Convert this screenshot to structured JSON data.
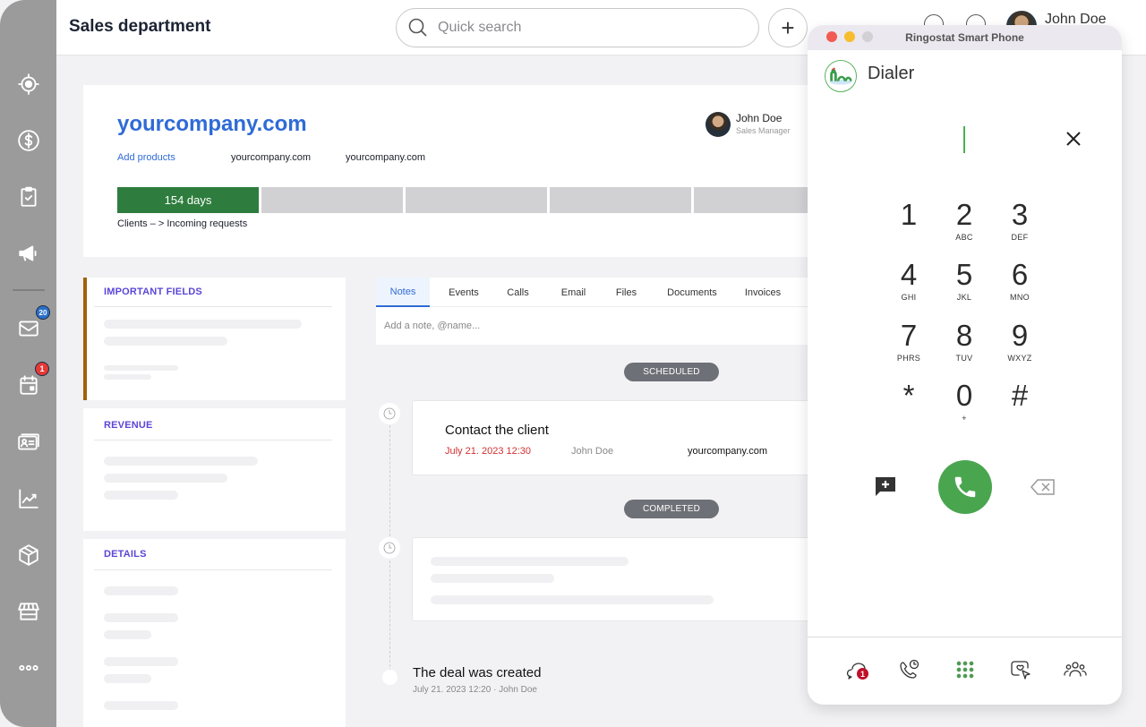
{
  "header": {
    "title": "Sales department",
    "search_placeholder": "Quick search",
    "add_button": "+",
    "user_name": "John Doe"
  },
  "sidebar": {
    "items": [
      {
        "name": "target",
        "icon": "target-icon"
      },
      {
        "name": "deals",
        "icon": "dollar-icon"
      },
      {
        "name": "tasks",
        "icon": "clipboard-check-icon"
      },
      {
        "name": "marketing",
        "icon": "megaphone-icon"
      },
      {
        "name": "mail",
        "icon": "mail-icon",
        "badge": "20"
      },
      {
        "name": "calendar",
        "icon": "calendar-icon",
        "badge": "1"
      },
      {
        "name": "contacts",
        "icon": "contact-cards-icon"
      },
      {
        "name": "analytics",
        "icon": "chart-icon"
      },
      {
        "name": "products",
        "icon": "box-icon"
      },
      {
        "name": "store",
        "icon": "store-icon"
      },
      {
        "name": "more",
        "icon": "more-icon"
      }
    ]
  },
  "deal": {
    "title": "yourcompany.com",
    "add_products": "Add products",
    "meta1": "yourcompany.com",
    "meta2": "yourcompany.com",
    "owner_name": "John Doe",
    "owner_role": "Sales Manager",
    "stages": [
      {
        "label": "154 days",
        "active": true
      },
      {
        "label": "",
        "active": false
      },
      {
        "label": "",
        "active": false
      },
      {
        "label": "",
        "active": false
      },
      {
        "label": "",
        "active": false
      }
    ],
    "pipeline": "Clients – > Incoming requests"
  },
  "panels": {
    "important": "IMPORTANT FIELDS",
    "revenue": "REVENUE",
    "details": "DETAILS"
  },
  "activity": {
    "tabs": [
      "Notes",
      "Events",
      "Calls",
      "Email",
      "Files",
      "Documents",
      "Invoices"
    ],
    "active_tab": "Notes",
    "note_placeholder": "Add a note, @name...",
    "scheduled_label": "SCHEDULED",
    "completed_label": "COMPLETED",
    "task": {
      "title": "Contact the client",
      "date": "July 21. 2023 12:30",
      "user": "John Doe",
      "company": "yourcompany.com"
    },
    "created": {
      "title": "The deal was created",
      "meta": "July 21. 2023 12:20 · John Doe"
    }
  },
  "phone": {
    "window_title": "Ringostat Smart Phone",
    "dialer_title": "Dialer",
    "keys": [
      {
        "digit": "1",
        "letters": ""
      },
      {
        "digit": "2",
        "letters": "ABC"
      },
      {
        "digit": "3",
        "letters": "DEF"
      },
      {
        "digit": "4",
        "letters": "GHI"
      },
      {
        "digit": "5",
        "letters": "JKL"
      },
      {
        "digit": "6",
        "letters": "MNO"
      },
      {
        "digit": "7",
        "letters": "PHRS"
      },
      {
        "digit": "8",
        "letters": "TUV"
      },
      {
        "digit": "9",
        "letters": "WXYZ"
      },
      {
        "digit": "*",
        "letters": ""
      },
      {
        "digit": "0",
        "letters": "+"
      },
      {
        "digit": "#",
        "letters": ""
      }
    ],
    "nav": [
      {
        "name": "chats",
        "icon": "chat-bubbles-icon",
        "badge": "1"
      },
      {
        "name": "call-history",
        "icon": "phone-clock-icon"
      },
      {
        "name": "dialpad",
        "icon": "dialpad-icon"
      },
      {
        "name": "callback",
        "icon": "callback-widget-icon"
      },
      {
        "name": "contacts",
        "icon": "people-icon"
      }
    ],
    "colors": {
      "call": "#4aa54f",
      "accent": "#4caf50",
      "badge": "#c0102a"
    }
  }
}
